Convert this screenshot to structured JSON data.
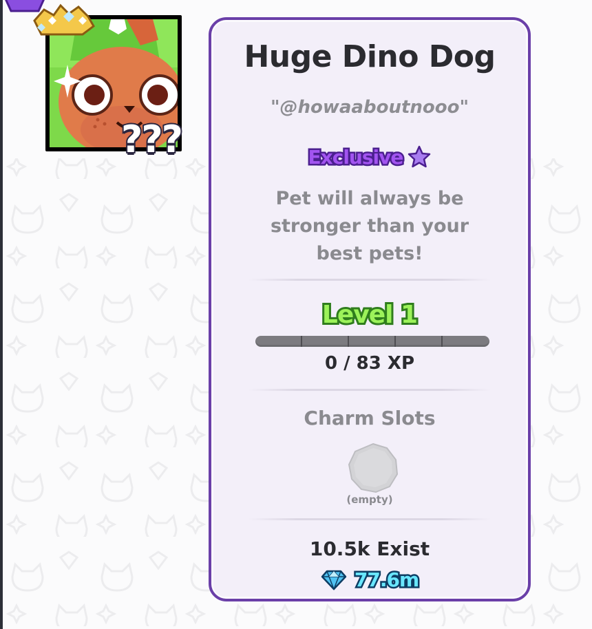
{
  "pet": {
    "name": "Huge Dino Dog",
    "nickname": "\"@howaaboutnooo\"",
    "unknown_badge": "???",
    "rarity": "Exclusive",
    "description": "Pet will always be stronger than your best pets!",
    "level_label": "Level 1",
    "xp_text": "0 / 83 XP",
    "xp_progress": 0,
    "charm_slots_title": "Charm Slots",
    "charm_slot_empty": "(empty)",
    "exist_count": "10.5k Exist",
    "value": "77.6m"
  },
  "icons": {
    "rarity": "star-icon",
    "value": "diamond-icon",
    "corner": "gem-crown-icon",
    "charm": "empty-charm-slot-icon"
  },
  "colors": {
    "card_border": "#6a3fa8",
    "card_background": "#f3eff9",
    "rarity_text": "#a254f0",
    "level_text": "#9cf25a",
    "value_text": "#69e7ff",
    "pet_background": "#7ed94a",
    "pet_fur": "#e07b4a"
  }
}
